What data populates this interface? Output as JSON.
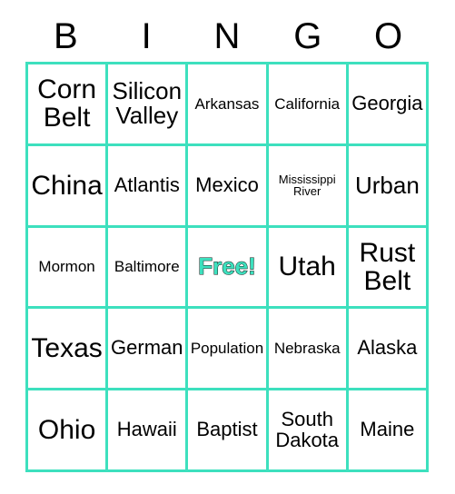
{
  "card": {
    "title": "BINGO",
    "border_color": "#3DE0BE",
    "free_text_color": "#3DE0BE",
    "text_color": "#000000",
    "background_color": "#FFFFFF"
  },
  "header": {
    "letters": [
      "B",
      "I",
      "N",
      "G",
      "O"
    ]
  },
  "grid": {
    "rows": 5,
    "columns": 5,
    "cells": [
      [
        {
          "text": "Corn Belt",
          "size": "fs-xl",
          "free": false
        },
        {
          "text": "Silicon Valley",
          "size": "fs-lg",
          "free": false
        },
        {
          "text": "Arkansas",
          "size": "fs-sm",
          "free": false
        },
        {
          "text": "California",
          "size": "fs-sm",
          "free": false
        },
        {
          "text": "Georgia",
          "size": "fs-md",
          "free": false
        }
      ],
      [
        {
          "text": "China",
          "size": "fs-xl",
          "free": false
        },
        {
          "text": "Atlantis",
          "size": "fs-md",
          "free": false
        },
        {
          "text": "Mexico",
          "size": "fs-md",
          "free": false
        },
        {
          "text": "Mississippi River",
          "size": "fs-xs",
          "free": false
        },
        {
          "text": "Urban",
          "size": "fs-lg",
          "free": false
        }
      ],
      [
        {
          "text": "Mormon",
          "size": "fs-sm",
          "free": false
        },
        {
          "text": "Baltimore",
          "size": "fs-sm",
          "free": false
        },
        {
          "text": "Free!",
          "size": "fs-lg",
          "free": true
        },
        {
          "text": "Utah",
          "size": "fs-xl",
          "free": false
        },
        {
          "text": "Rust Belt",
          "size": "fs-xl",
          "free": false
        }
      ],
      [
        {
          "text": "Texas",
          "size": "fs-xl",
          "free": false
        },
        {
          "text": "German",
          "size": "fs-md",
          "free": false
        },
        {
          "text": "Population",
          "size": "fs-sm",
          "free": false
        },
        {
          "text": "Nebraska",
          "size": "fs-sm",
          "free": false
        },
        {
          "text": "Alaska",
          "size": "fs-md",
          "free": false
        }
      ],
      [
        {
          "text": "Ohio",
          "size": "fs-xl",
          "free": false
        },
        {
          "text": "Hawaii",
          "size": "fs-md",
          "free": false
        },
        {
          "text": "Baptist",
          "size": "fs-md",
          "free": false
        },
        {
          "text": "South Dakota",
          "size": "fs-md",
          "free": false
        },
        {
          "text": "Maine",
          "size": "fs-md",
          "free": false
        }
      ]
    ]
  }
}
